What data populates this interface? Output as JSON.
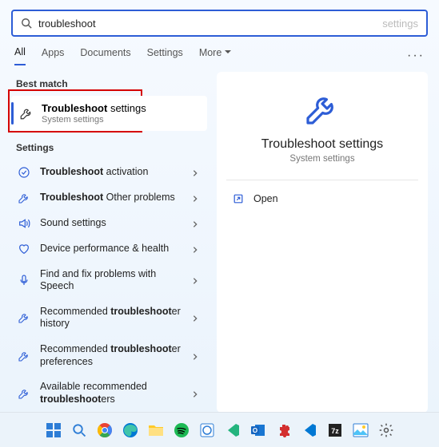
{
  "search": {
    "value": "troubleshoot",
    "placeholder": "settings"
  },
  "tabs": {
    "all": "All",
    "apps": "Apps",
    "documents": "Documents",
    "settings": "Settings",
    "more": "More"
  },
  "sections": {
    "best_match": "Best match",
    "settings": "Settings"
  },
  "best_match": {
    "title_bold": "Troubleshoot",
    "title_rest": " settings",
    "subtitle": "System settings"
  },
  "settings_items": [
    {
      "icon": "check-circle",
      "bold": "Troubleshoot",
      "rest": " activation"
    },
    {
      "icon": "wrench",
      "bold": "Troubleshoot",
      "rest": " Other problems"
    },
    {
      "icon": "speaker",
      "pre": "Sound settings",
      "bold": "",
      "rest": ""
    },
    {
      "icon": "heart",
      "pre": "Device performance & health",
      "bold": "",
      "rest": ""
    },
    {
      "icon": "mic",
      "pre": "Find and fix problems with Speech",
      "bold": "",
      "rest": ""
    },
    {
      "icon": "wrench",
      "pre": "Recommended ",
      "bold": "troubleshoot",
      "rest": "er history"
    },
    {
      "icon": "wrench",
      "pre": "Recommended ",
      "bold": "troubleshoot",
      "rest": "er preferences"
    },
    {
      "icon": "wrench",
      "pre": "Available recommended ",
      "bold": "troubleshoot",
      "rest": "ers"
    }
  ],
  "preview": {
    "title": "Troubleshoot settings",
    "subtitle": "System settings",
    "action_open": "Open"
  },
  "taskbar": {
    "items": [
      "start",
      "search",
      "chrome",
      "edge",
      "explorer",
      "spotify",
      "azure",
      "vscode-insiders",
      "outlook",
      "extension",
      "vscode",
      "7zip",
      "photos",
      "settings"
    ]
  }
}
